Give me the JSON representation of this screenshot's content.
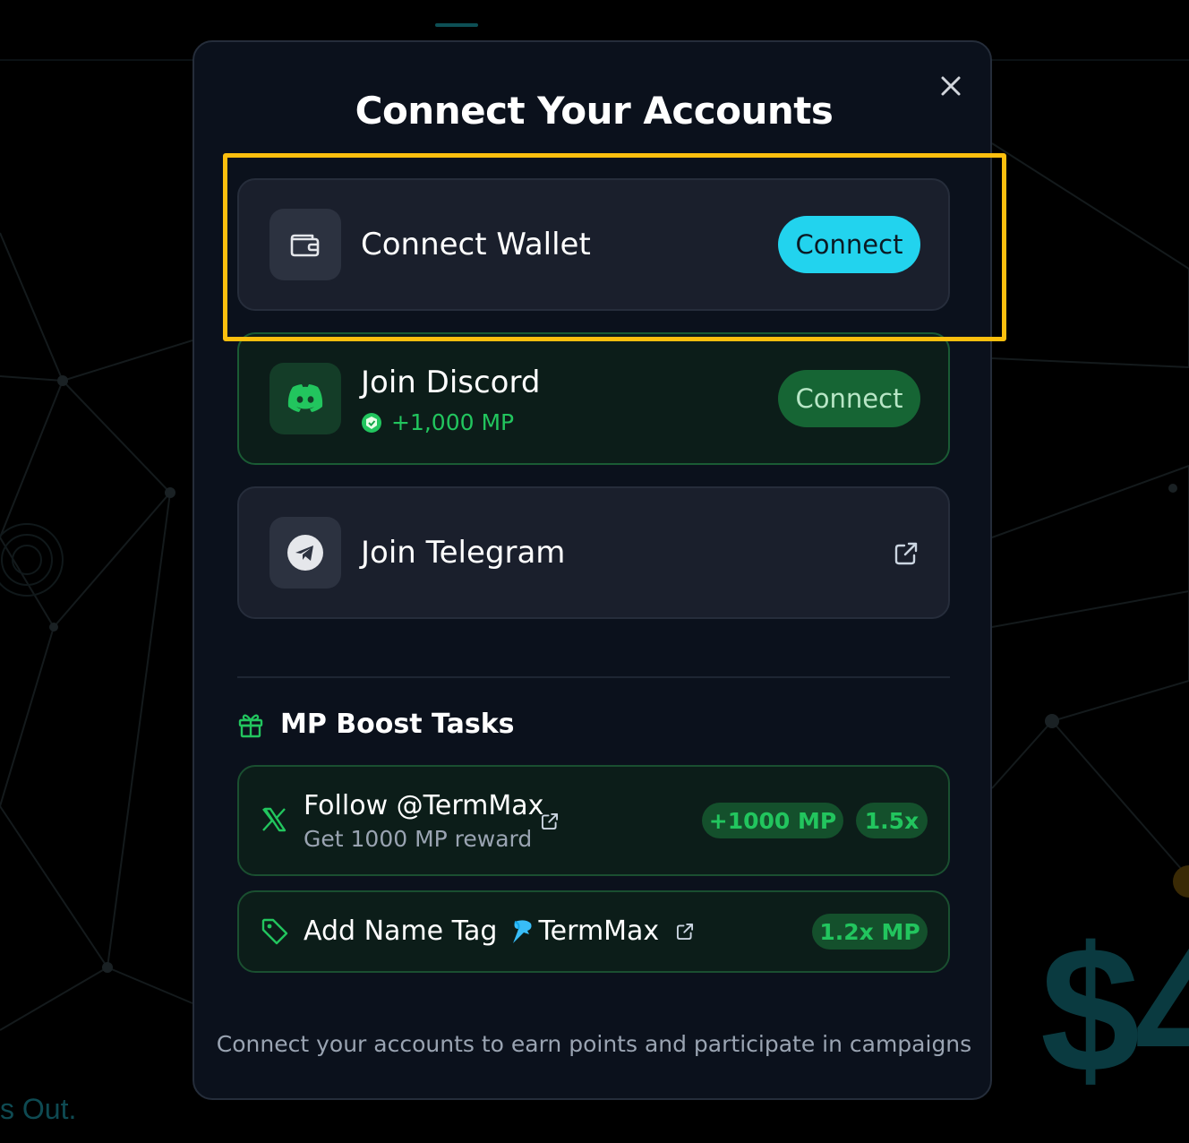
{
  "background": {
    "partial_text": "s Out.",
    "partial_price": "$4"
  },
  "modal": {
    "title": "Connect Your Accounts",
    "close_icon": "close-icon",
    "accounts": [
      {
        "label": "Connect Wallet",
        "icon": "wallet-icon",
        "button": "Connect",
        "button_color": "#22d3ee"
      },
      {
        "label": "Join Discord",
        "icon": "discord-icon",
        "reward": "+1,000 MP",
        "button": "Connect",
        "button_color": "#166534"
      },
      {
        "label": "Join Telegram",
        "icon": "telegram-icon",
        "action_icon": "external-link-icon"
      }
    ],
    "boost": {
      "heading": "MP Boost Tasks",
      "icon": "gift-icon",
      "tasks": [
        {
          "title": "Follow @TermMax",
          "subtitle": "Get 1000 MP reward",
          "icon": "x-logo-icon",
          "points": "+1000 MP",
          "multiplier": "1.5x"
        },
        {
          "title_prefix": "Add Name Tag",
          "title_brand": "TermMax",
          "brand_icon": "dolphin-icon",
          "icon": "tag-icon",
          "multiplier": "1.2x MP"
        }
      ]
    },
    "footer": "Connect your accounts to earn points and participate in campaigns"
  },
  "colors": {
    "accent_cyan": "#22d3ee",
    "accent_green": "#22c55e",
    "highlight": "#fcbf0e",
    "modal_bg": "#0b111c"
  }
}
